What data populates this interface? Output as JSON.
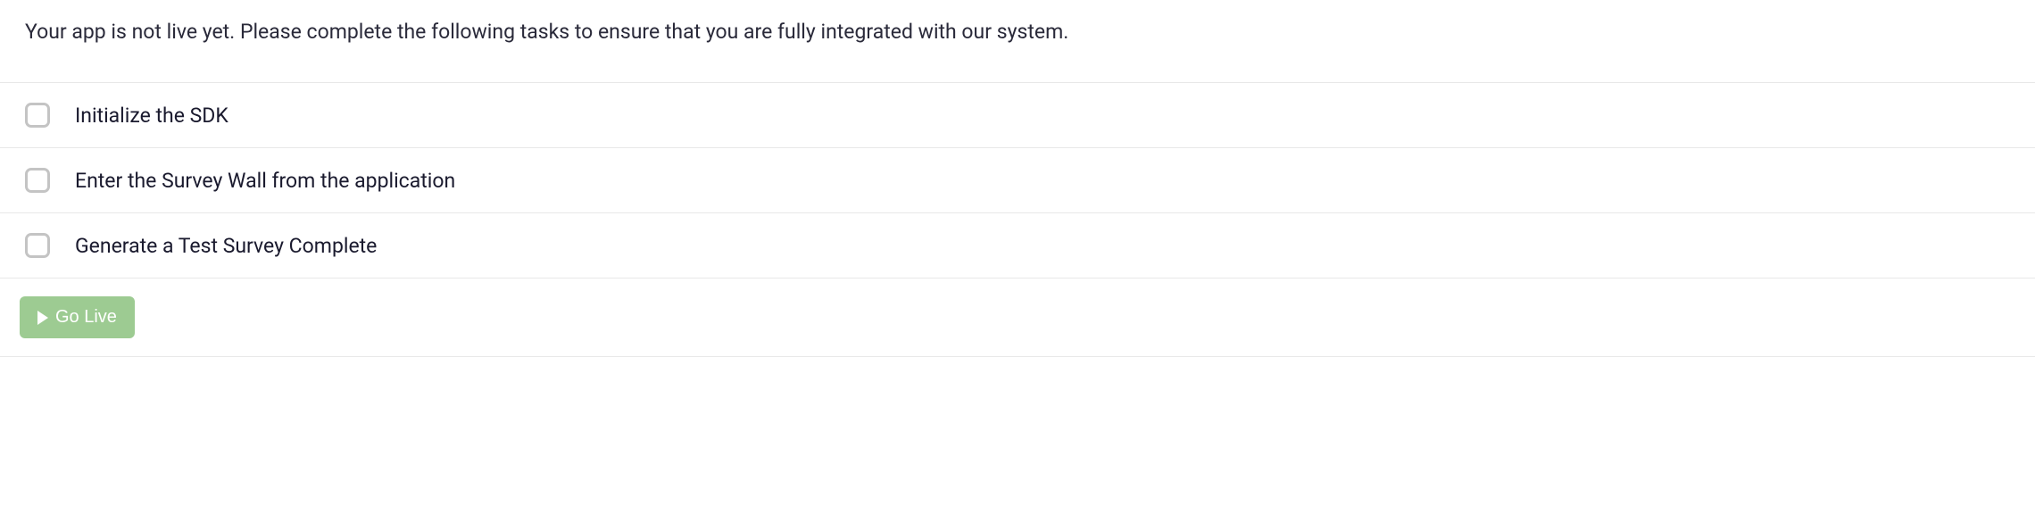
{
  "intro": "Your app is not live yet. Please complete the following tasks to ensure that you are fully integrated with our system.",
  "tasks": [
    {
      "label": "Initialize the SDK",
      "checked": false
    },
    {
      "label": "Enter the Survey Wall from the application",
      "checked": false
    },
    {
      "label": "Generate a Test Survey Complete",
      "checked": false
    }
  ],
  "actions": {
    "go_live_label": "Go Live"
  }
}
